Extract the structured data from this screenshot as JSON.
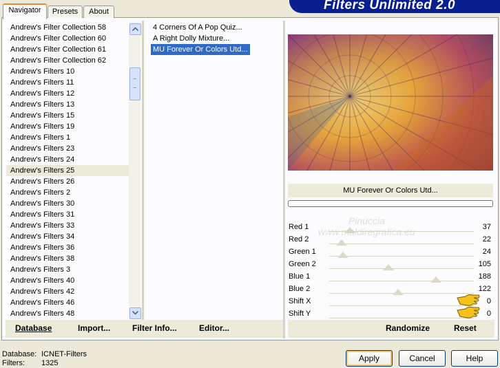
{
  "header": {
    "title": "Filters Unlimited 2.0"
  },
  "tabs": [
    {
      "label": "Navigator",
      "active": true
    },
    {
      "label": "Presets",
      "active": false
    },
    {
      "label": "About",
      "active": false
    }
  ],
  "categories": [
    "Andrew's Filter Collection 58",
    "Andrew's Filter Collection 60",
    "Andrew's Filter Collection 61",
    "Andrew's Filter Collection 62",
    "Andrew's Filters 10",
    "Andrew's Filters 11",
    "Andrew's Filters 12",
    "Andrew's Filters 13",
    "Andrew's Filters 15",
    "Andrew's Filters 19",
    "Andrew's Filters 1",
    "Andrew's Filters 23",
    "Andrew's Filters 24",
    "Andrew's Filters 25",
    "Andrew's Filters 26",
    "Andrew's Filters 2",
    "Andrew's Filters 30",
    "Andrew's Filters 31",
    "Andrew's Filters 33",
    "Andrew's Filters 34",
    "Andrew's Filters 36",
    "Andrew's Filters 38",
    "Andrew's Filters 3",
    "Andrew's Filters 40",
    "Andrew's Filters 42",
    "Andrew's Filters 46",
    "Andrew's Filters 48"
  ],
  "selected_category": "Andrew's Filters 25",
  "filters": [
    "4 Corners Of A Pop Quiz...",
    "A Right Dolly Mixture...",
    "MU Forever Or Colors Utd..."
  ],
  "selected_filter": "MU Forever Or Colors Utd...",
  "preview": {
    "filter_name": "MU Forever Or Colors Utd...",
    "progress": 0
  },
  "sliders": [
    {
      "label": "Red 1",
      "value": "37",
      "level": 37
    },
    {
      "label": "Red 2",
      "value": "22",
      "level": 22
    },
    {
      "label": "Green 1",
      "value": "24",
      "level": 24
    },
    {
      "label": "Green 2",
      "value": "105",
      "level": 105
    },
    {
      "label": "Blue 1",
      "value": "188",
      "level": 188
    },
    {
      "label": "Blue 2",
      "value": "122",
      "level": 122
    },
    {
      "label": "Shift X",
      "value": "0",
      "level": 0
    },
    {
      "label": "Shift Y",
      "value": "0",
      "level": 0
    }
  ],
  "watermark": {
    "line1": "Pinuccia",
    "line2": "www.maldiregrafica.eu"
  },
  "left_links": {
    "database": "Database",
    "import": "Import...",
    "filter_info": "Filter Info...",
    "editor": "Editor..."
  },
  "right_links": {
    "randomize": "Randomize",
    "reset": "Reset"
  },
  "status": {
    "database_label": "Database:",
    "database_value": "ICNET-Filters",
    "filters_label": "Filters:",
    "filters_value": "1325"
  },
  "buttons": {
    "apply": "Apply",
    "cancel": "Cancel",
    "help": "Help"
  },
  "colors": {
    "banner": "#0a1f8f",
    "selection": "#316ac5",
    "tab_accent": "#e68b2c",
    "dialog_bg": "#ece9d8"
  }
}
